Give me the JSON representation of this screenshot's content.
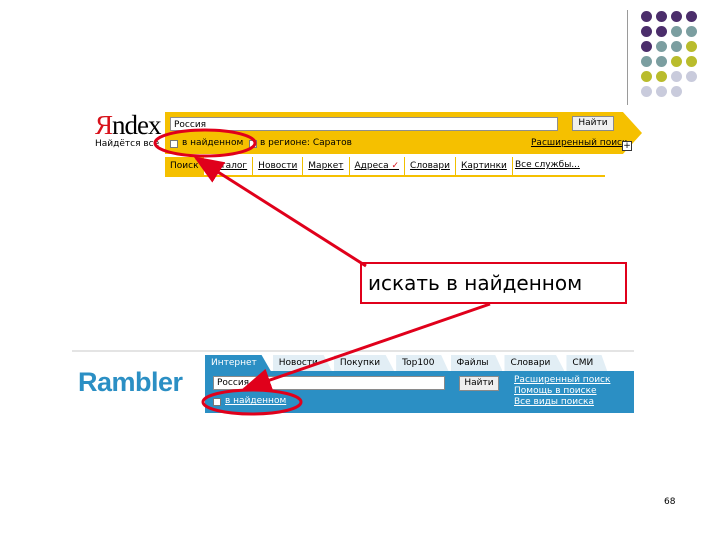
{
  "decor": {
    "dots": [
      [
        "#4b2d6b",
        "#4b2d6b",
        "#4b2d6b",
        "#4b2d6b"
      ],
      [
        "#4b2d6b",
        "#4b2d6b",
        "#7b9ea0",
        "#7b9ea0"
      ],
      [
        "#4b2d6b",
        "#7b9ea0",
        "#7b9ea0",
        "#b9bc2c"
      ],
      [
        "#7b9ea0",
        "#7b9ea0",
        "#b9bc2c",
        "#b9bc2c"
      ],
      [
        "#b9bc2c",
        "#b9bc2c",
        "#c9cbdc",
        "#c9cbdc"
      ],
      [
        "#c9cbdc",
        "#c9cbdc",
        "#c9cbdc",
        "#ffffff"
      ]
    ]
  },
  "yandex": {
    "logo_first": "Я",
    "logo_rest": "ndex",
    "tagline": "Найдётся всё",
    "query": "Россия",
    "find_button": "Найти",
    "search_in_found": "в найденном",
    "region_label": "в регионе: Саратов",
    "advanced_search": "Расширенный поиск",
    "plus": "+",
    "tabs": [
      "Поиск",
      "Каталог",
      "Новости",
      "Маркет",
      "Адреса",
      "Словари",
      "Картинки"
    ],
    "tick": "✓",
    "more_services": "Все службы..."
  },
  "callout": {
    "text": "искать в найденном"
  },
  "rambler": {
    "logo": "Rambler",
    "tabs": [
      "Интернет",
      "Новости",
      "Покупки",
      "Top100",
      "Файлы",
      "Словари",
      "СМИ"
    ],
    "query": "Россия",
    "find_button": "Найти",
    "search_in_found": "в найденном",
    "links": [
      "Расширенный поиск",
      "Помощь в поиске",
      "Все виды поиска"
    ]
  },
  "page": {
    "number": "68"
  },
  "colors": {
    "yandex_yellow": "#f5c000",
    "rambler_blue": "#2b8fc4",
    "highlight_red": "#e0001b"
  }
}
